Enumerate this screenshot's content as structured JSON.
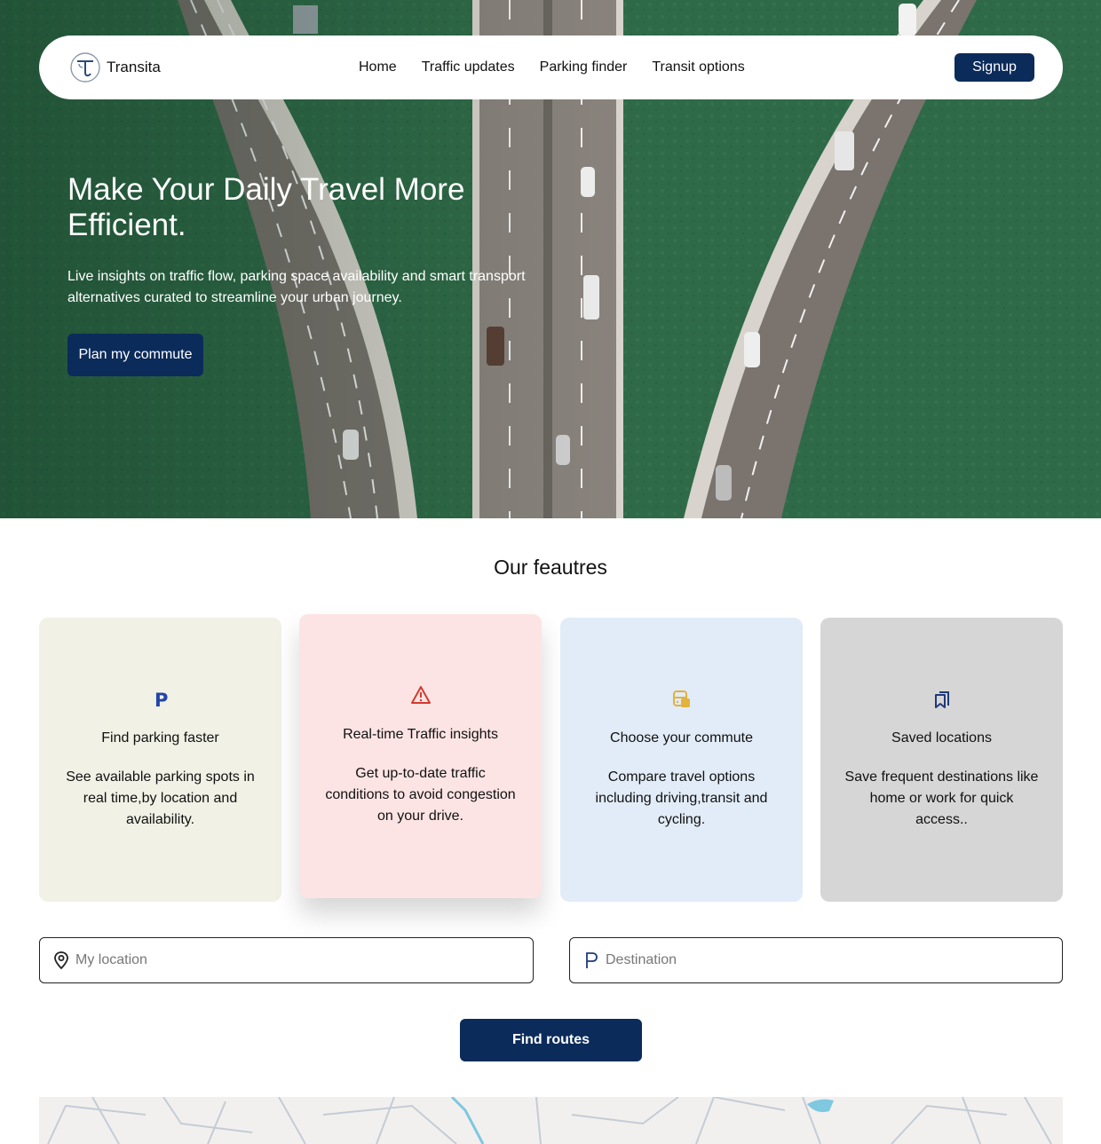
{
  "nav": {
    "brand": "Transita",
    "links": [
      "Home",
      "Traffic updates",
      "Parking finder",
      "Transit options"
    ],
    "signup_label": "Signup"
  },
  "hero": {
    "title": "Make Your Daily Travel More Efficient.",
    "subtitle": "Live insights on traffic flow, parking space availability and smart transport alternatives curated to streamline your urban journey.",
    "cta_label": "Plan my commute"
  },
  "features": {
    "title": "Our feautres",
    "cards": [
      {
        "icon": "parking-icon",
        "title": "Find parking faster",
        "desc": "See available parking spots in real time,by location and availability.",
        "bg": "#f1f1e6",
        "icon_color": "#2244aa"
      },
      {
        "icon": "warning-icon",
        "title": "Real-time Traffic insights",
        "desc": "Get up-to-date traffic conditions to avoid congestion on your drive.",
        "bg": "#fde4e4",
        "icon_color": "#d23b2f"
      },
      {
        "icon": "transit-icon",
        "title": "Choose your commute",
        "desc": "Compare travel options including driving,transit and cycling.",
        "bg": "#e2ecf8",
        "icon_color": "#e2b23a"
      },
      {
        "icon": "bookmarks-icon",
        "title": "Saved locations",
        "desc": "Save frequent destinations like home or work for quick access..",
        "bg": "#d6d6d6",
        "icon_color": "#1f3a7a"
      }
    ]
  },
  "search": {
    "location_placeholder": "My location",
    "destination_placeholder": "Destination",
    "find_label": "Find routes"
  },
  "colors": {
    "primary": "#0b2b5a",
    "hero_water": "#2f6a48"
  }
}
